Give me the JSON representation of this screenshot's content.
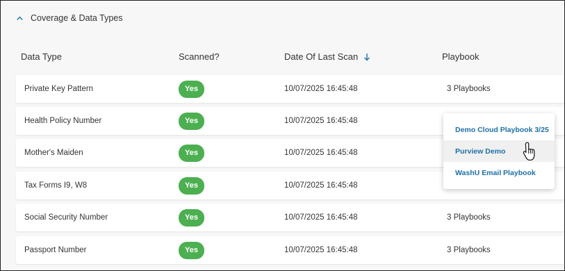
{
  "section": {
    "title": "Coverage & Data Types",
    "expanded": true
  },
  "columns": {
    "data_type": "Data Type",
    "scanned": "Scanned?",
    "date": "Date Of Last Scan",
    "playbook": "Playbook"
  },
  "rows": [
    {
      "data_type": "Private Key Pattern",
      "scanned": "Yes",
      "date": "10/07/2025 16:45:48",
      "playbook": "3 Playbooks"
    },
    {
      "data_type": "Health Policy Number",
      "scanned": "Yes",
      "date": "10/07/2025 16:45:48",
      "playbook": ""
    },
    {
      "data_type": "Mother's Maiden",
      "scanned": "Yes",
      "date": "10/07/2025 16:45:48",
      "playbook": ""
    },
    {
      "data_type": "Tax Forms I9, W8",
      "scanned": "Yes",
      "date": "10/07/2025 16:45:48",
      "playbook": ""
    },
    {
      "data_type": "Social Security Number",
      "scanned": "Yes",
      "date": "10/07/2025 16:45:48",
      "playbook": "3 Playbooks"
    },
    {
      "data_type": "Passport Number",
      "scanned": "Yes",
      "date": "10/07/2025 16:45:48",
      "playbook": "3 Playbooks"
    }
  ],
  "playbook_popup": {
    "items": [
      {
        "label": "Demo Cloud Playbook 3/25"
      },
      {
        "label": "Purview Demo"
      },
      {
        "label": "WashU Email Playbook"
      }
    ],
    "hovered_index": 1
  },
  "colors": {
    "accent": "#1e6fa8",
    "yes_badge": "#4caf50",
    "background": "#f7f7f7"
  },
  "icons": {
    "section_toggle": "chevron-up-icon",
    "sort": "arrow-down-icon",
    "cursor": "hand-pointer-icon"
  }
}
